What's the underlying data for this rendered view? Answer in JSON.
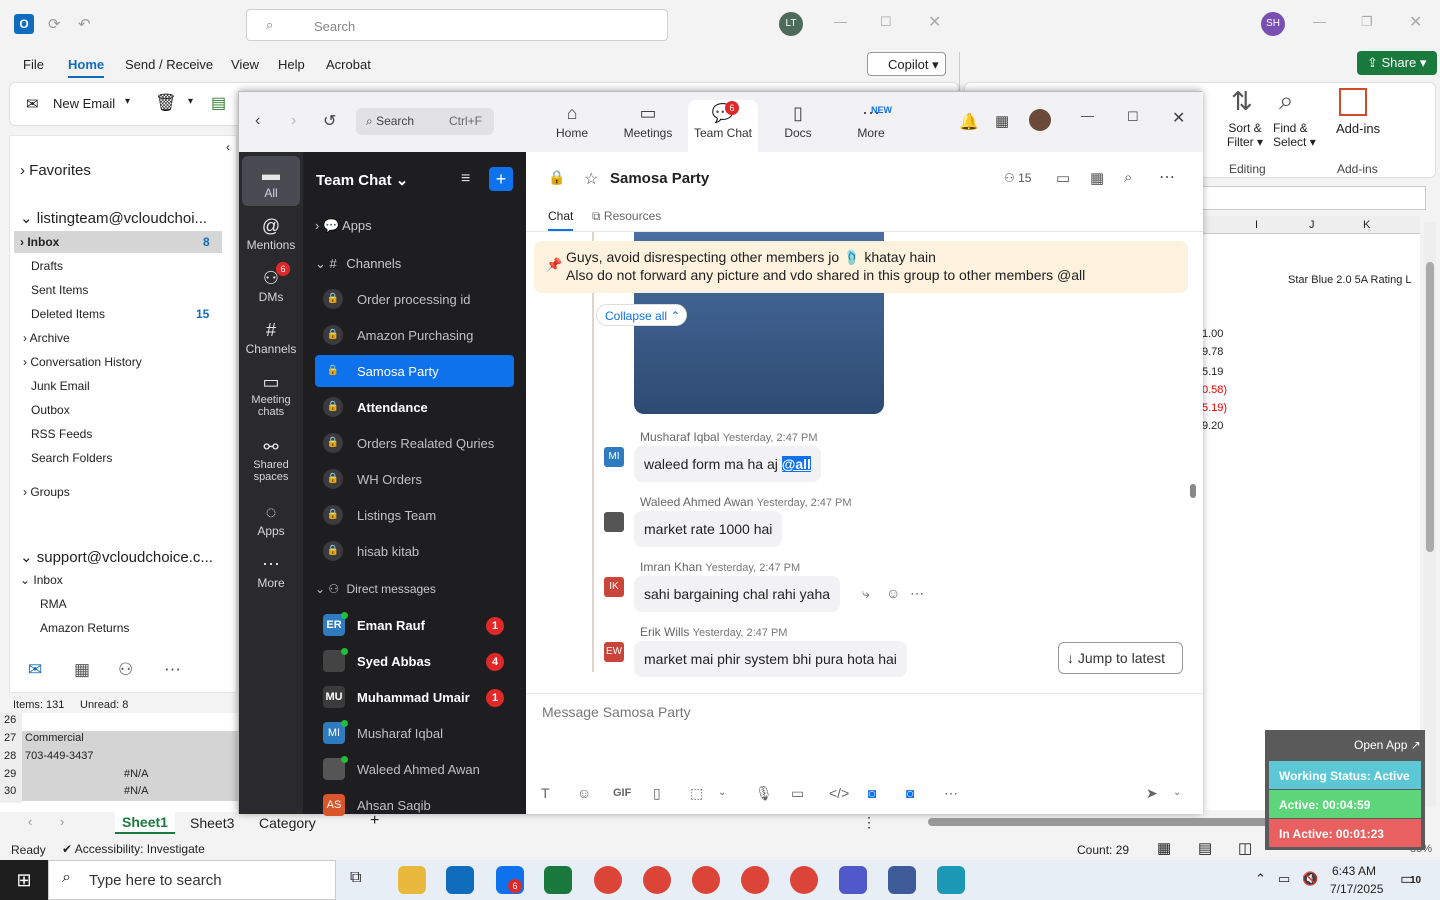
{
  "outlook": {
    "search_placeholder": "Search",
    "avatar": "LT",
    "menu": [
      "File",
      "Home",
      "Send / Receive",
      "View",
      "Help",
      "Acrobat"
    ],
    "copilot": "Copilot",
    "new_email": "New Email",
    "folders": {
      "favorites": "Favorites",
      "account1": "listingteam@vcloudchoi...",
      "inbox": "Inbox",
      "inbox_count": "8",
      "drafts": "Drafts",
      "sent": "Sent Items",
      "deleted": "Deleted Items",
      "deleted_count": "15",
      "archive": "Archive",
      "conv": "Conversation History",
      "junk": "Junk Email",
      "outbox": "Outbox",
      "rss": "RSS Feeds",
      "searchf": "Search Folders",
      "groups": "Groups",
      "account2": "support@vcloudchoice.c...",
      "inbox2": "Inbox",
      "rma": "RMA",
      "amazon": "Amazon Returns"
    },
    "status": {
      "items": "Items: 131",
      "unread": "Unread: 8"
    }
  },
  "excel": {
    "avatar": "SH",
    "share": "Share",
    "ribbon": {
      "sort": "Sort &",
      "filter": "Filter",
      "find": "Find &",
      "select": "Select",
      "addins": "Add-ins",
      "editing": "Editing",
      "addins_grp": "Add-ins"
    },
    "cols": [
      "I",
      "J",
      "K"
    ],
    "header_cell": "Star Blue 2.0 5A Rating L",
    "values": [
      "1.00",
      "9.78",
      "5.19",
      "0.58)",
      "5.19)",
      "9.20"
    ],
    "rows_left": [
      {
        "n": "26",
        "v": ""
      },
      {
        "n": "27",
        "v": "Commercial"
      },
      {
        "n": "28",
        "v": "703-449-3437"
      },
      {
        "n": "29",
        "v": "#N/A"
      },
      {
        "n": "30",
        "v": "#N/A"
      }
    ],
    "sheets": [
      "Sheet1",
      "Sheet3",
      "Category"
    ],
    "status_ready": "Ready",
    "accessibility": "Accessibility: Investigate",
    "count": "Count: 29",
    "zoom_pct": "85%"
  },
  "zoom": {
    "search": "Search",
    "shortcut": "Ctrl+F",
    "tabs": [
      {
        "label": "Home"
      },
      {
        "label": "Meetings"
      },
      {
        "label": "Team Chat",
        "badge": "6"
      },
      {
        "label": "Docs"
      },
      {
        "label": "More",
        "tag": "NEW"
      }
    ],
    "rail": [
      {
        "label": "All"
      },
      {
        "label": "Mentions"
      },
      {
        "label": "DMs",
        "badge": "6"
      },
      {
        "label": "Channels"
      },
      {
        "label": "Meeting chats"
      },
      {
        "label": "Shared spaces"
      },
      {
        "label": "Apps"
      },
      {
        "label": "More"
      }
    ],
    "sidebar_title": "Team Chat",
    "apps": "Apps",
    "channels": "Channels",
    "channel_list": [
      "Order processing id",
      "Amazon Purchasing",
      "Samosa Party",
      "Attendance",
      "Orders Realated Quries",
      "WH Orders",
      "Listings Team",
      "hisab kitab"
    ],
    "dm_header": "Direct messages",
    "dms": [
      {
        "name": "Eman Rauf",
        "init": "ER",
        "badge": "1",
        "color": "#2f7bbf"
      },
      {
        "name": "Syed Abbas",
        "init": "",
        "badge": "4",
        "color": "#444"
      },
      {
        "name": "Muhammad Umair",
        "init": "MU",
        "badge": "1",
        "color": "#3b3b3b"
      },
      {
        "name": "Musharaf Iqbal",
        "init": "MI",
        "badge": "",
        "color": "#2f7bbf"
      },
      {
        "name": "Waleed Ahmed Awan",
        "init": "",
        "badge": "",
        "color": "#555"
      },
      {
        "name": "Ahsan Saqib",
        "init": "AS",
        "badge": "",
        "color": "#d9552b"
      }
    ],
    "chat_title": "Samosa Party",
    "members": "15",
    "subtabs": [
      "Chat",
      "Resources"
    ],
    "pinned_line1": "Guys, avoid disrespecting other members jo 🩴 khatay hain",
    "pinned_line2": "Also do not forward any picture and vdo shared in this group to other members @all",
    "collapse": "Collapse all",
    "messages": [
      {
        "name": "Musharaf Iqbal",
        "time": "Yesterday, 2:47 PM",
        "text": "waleed form ma ha aj ",
        "mention": "@all",
        "init": "MI",
        "color": "#2f7bbf"
      },
      {
        "name": "Waleed Ahmed Awan",
        "time": "Yesterday, 2:47 PM",
        "text": "market rate 1000 hai",
        "init": "",
        "color": "#555"
      },
      {
        "name": "Imran Khan",
        "time": "Yesterday, 2:47 PM",
        "text": "sahi bargaining chal rahi yaha",
        "init": "IK",
        "color": "#c9453b"
      },
      {
        "name": "Erik Wills",
        "time": "Yesterday, 2:47 PM",
        "text": "market mai phir system bhi pura hota hai",
        "init": "EW",
        "color": "#c9453b"
      }
    ],
    "jump": "Jump to latest",
    "composer_placeholder": "Message Samosa Party",
    "gif": "GIF"
  },
  "timer": {
    "open_app": "Open App ↗",
    "working": "Working Status: Active",
    "active": "Active: 00:04:59",
    "inactive": "In Active: 00:01:23"
  },
  "taskbar": {
    "search": "Type here to search",
    "time": "6:43 AM",
    "date": "7/17/2025",
    "notif": "10",
    "zoom_badge": "6"
  }
}
